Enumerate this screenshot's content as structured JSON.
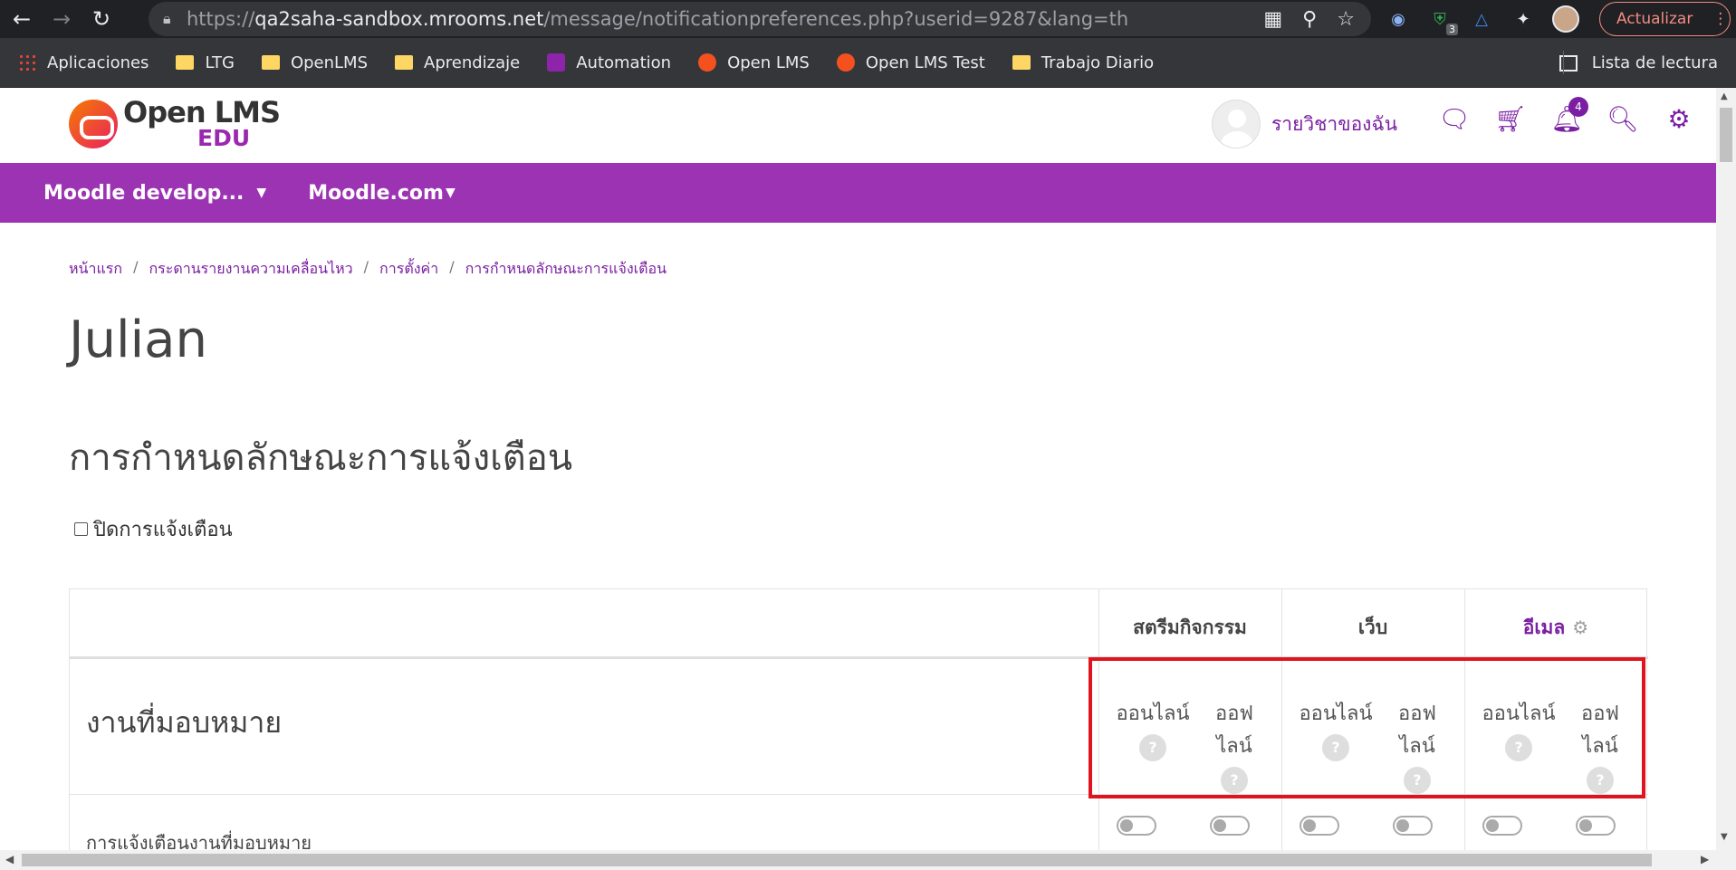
{
  "browser": {
    "url_prefix": "https://",
    "url_host": "qa2saha-sandbox.mrooms.net",
    "url_path": "/message/notificationpreferences.php?userid=9287&lang=th",
    "update_label": "Actualizar",
    "extension_badge": "3",
    "bookmarks": [
      "Aplicaciones",
      "LTG",
      "OpenLMS",
      "Aprendizaje",
      "Automation",
      "Open LMS",
      "Open LMS Test",
      "Trabajo Diario"
    ],
    "reading_list": "Lista de lectura"
  },
  "site": {
    "logo_line1": "Open LMS",
    "logo_line2": "EDU",
    "my_courses": "รายวิชาของฉัน",
    "notification_count": "4",
    "nav_menus": [
      "Moodle develop...",
      "Moodle.com"
    ]
  },
  "breadcrumb": [
    "หน้าแรก",
    "กระดานรายงานความเคลื่อนไหว",
    "การตั้งค่า",
    "การกำหนดลักษณะการแจ้งเตือน"
  ],
  "page_title": "Julian",
  "section_title": "การกำหนดลักษณะการแจ้งเตือน",
  "disable_label": "ปิดการแจ้งเตือน",
  "table": {
    "columns": [
      "สตรีมกิจกรรม",
      "เว็บ",
      "อีเมล"
    ],
    "group_title": "งานที่มอบหมาย",
    "state_online": "ออนไลน์",
    "state_offline_line1": "ออฟ",
    "state_offline_line2": "ไลน์",
    "help_glyph": "?",
    "item_label": "การแจ้งเตือนงานที่มอบหมาย"
  },
  "colors": {
    "brand_purple": "#9c33b3",
    "link_purple": "#7b1fa2",
    "highlight_red": "#e0141e"
  }
}
